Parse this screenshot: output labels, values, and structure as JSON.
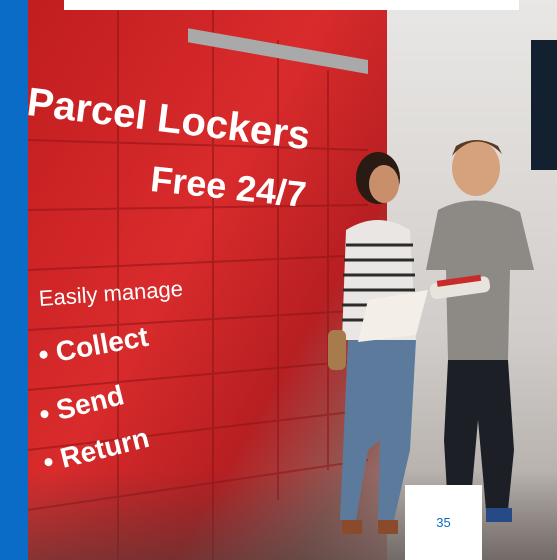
{
  "photo": {
    "headline_line1": "Parcel Lockers",
    "headline_line2": "Free 24/7",
    "subline": "Easily manage",
    "bullets": [
      "Collect",
      "Send",
      "Return"
    ]
  },
  "page": {
    "number": "35"
  },
  "colors": {
    "accent_blue": "#0a6cc6",
    "locker_red": "#d32a2b"
  },
  "icons": {
    "bullet": "bullet-dot-icon"
  }
}
